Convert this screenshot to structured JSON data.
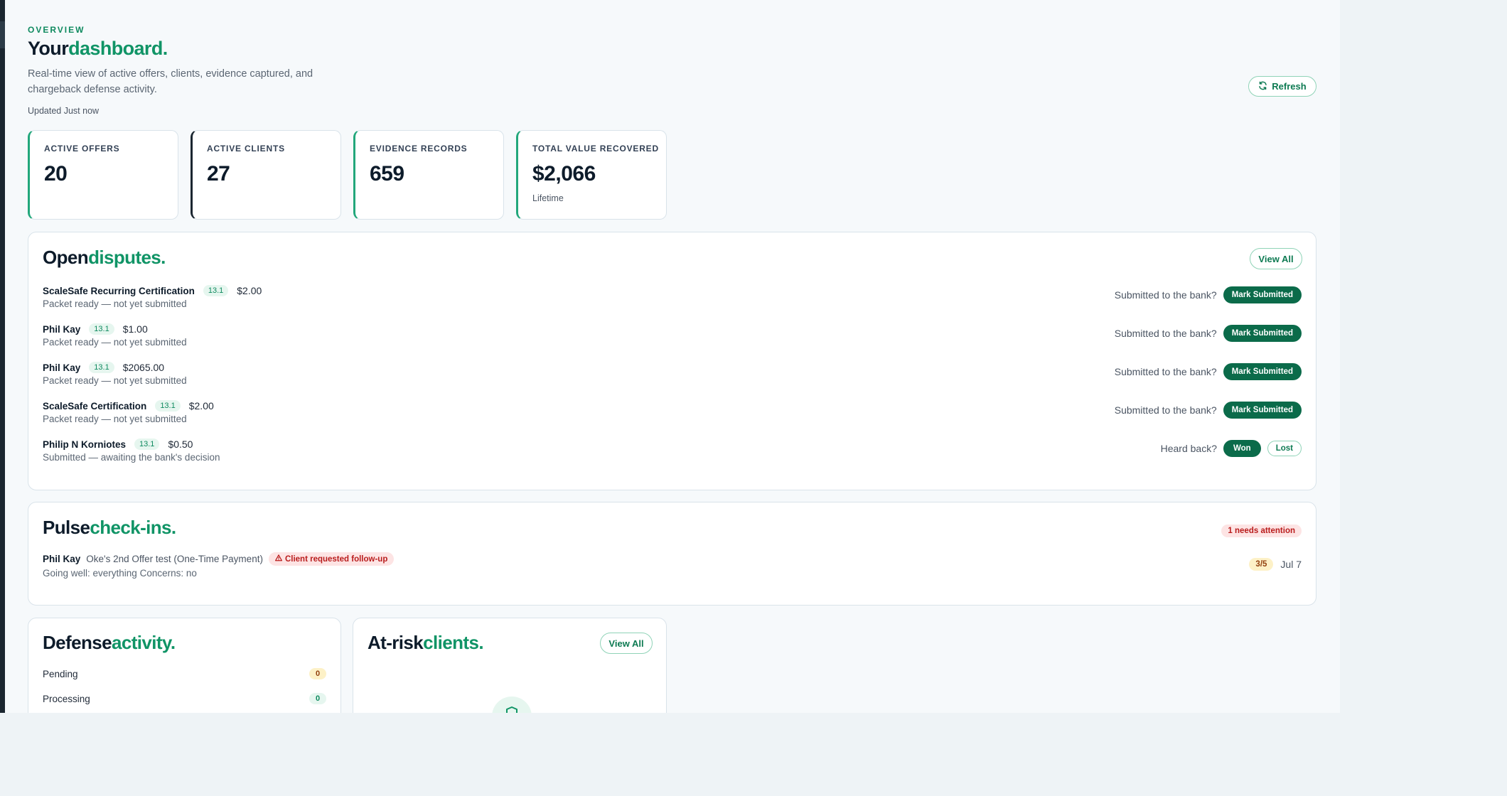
{
  "header": {
    "eyebrow": "OVERVIEW",
    "title_a": "Your",
    "title_b": "dashboard.",
    "subtitle": "Real-time view of active offers, clients, evidence captured, and chargeback defense activity.",
    "updated": "Updated Just now",
    "refresh_label": "Refresh"
  },
  "stats": [
    {
      "label": "ACTIVE OFFERS",
      "value": "20",
      "note": ""
    },
    {
      "label": "ACTIVE CLIENTS",
      "value": "27",
      "note": ""
    },
    {
      "label": "EVIDENCE RECORDS",
      "value": "659",
      "note": ""
    },
    {
      "label": "TOTAL VALUE RECOVERED",
      "value": "$2,066",
      "note": "Lifetime"
    }
  ],
  "disputes": {
    "title_a": "Open",
    "title_b": "disputes.",
    "view_all": "View All",
    "rows": [
      {
        "name": "ScaleSafe Recurring Certification",
        "version": "13.1",
        "amount": "$2.00",
        "status": "Packet ready — not yet submitted",
        "prompt": "Submitted to the bank?",
        "action": "Mark Submitted"
      },
      {
        "name": "Phil Kay",
        "version": "13.1",
        "amount": "$1.00",
        "status": "Packet ready — not yet submitted",
        "prompt": "Submitted to the bank?",
        "action": "Mark Submitted"
      },
      {
        "name": "Phil Kay",
        "version": "13.1",
        "amount": "$2065.00",
        "status": "Packet ready — not yet submitted",
        "prompt": "Submitted to the bank?",
        "action": "Mark Submitted"
      },
      {
        "name": "ScaleSafe Certification",
        "version": "13.1",
        "amount": "$2.00",
        "status": "Packet ready — not yet submitted",
        "prompt": "Submitted to the bank?",
        "action": "Mark Submitted"
      },
      {
        "name": "Philip N Korniotes",
        "version": "13.1",
        "amount": "$0.50",
        "status": "Submitted — awaiting the bank's decision",
        "prompt": "Heard back?",
        "won": "Won",
        "lost": "Lost"
      }
    ]
  },
  "pulse": {
    "title_a": "Pulse",
    "title_b": "check-ins.",
    "attention": "1 needs attention",
    "entry": {
      "name": "Phil Kay",
      "offer": "Oke's 2nd Offer test (One-Time Payment)",
      "flag": "Client requested follow-up",
      "note": "Going well: everything Concerns: no",
      "score": "3/5",
      "date": "Jul 7"
    }
  },
  "defense": {
    "title_a": "Defense",
    "title_b": "activity.",
    "rows": [
      {
        "label": "Pending",
        "count": "0"
      },
      {
        "label": "Processing",
        "count": "0"
      }
    ]
  },
  "atrisk": {
    "title_a": "At-risk",
    "title_b": "clients.",
    "view_all": "View All"
  },
  "icons": {
    "refresh": "refresh-icon",
    "warning": "warning-icon",
    "shield": "shield-icon"
  },
  "colors": {
    "accent": "#109466",
    "primary_button": "#0b6b4a",
    "danger_bg": "#fde4e4",
    "warning_bg": "#fdf1c7"
  }
}
